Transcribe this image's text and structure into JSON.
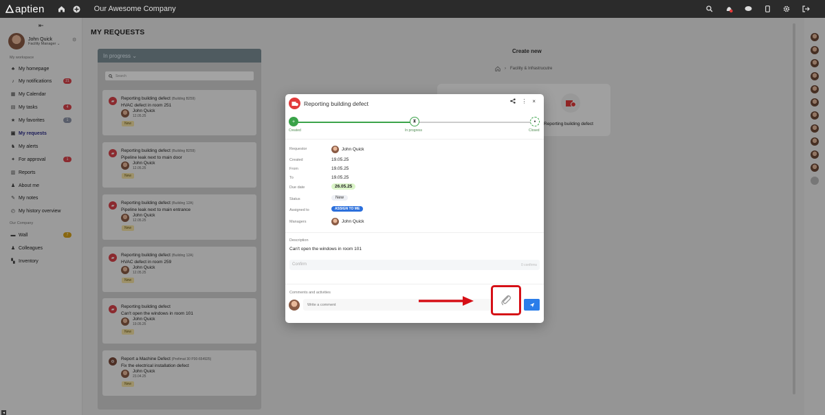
{
  "topbar": {
    "logo": "aptien",
    "company": "Our Awesome Company",
    "icons": [
      "home-icon",
      "add-icon",
      "search-icon",
      "alert-icon",
      "chat-icon",
      "mobile-icon",
      "settings-icon",
      "logout-icon"
    ]
  },
  "sidebar": {
    "user": {
      "name": "John Quick",
      "role": "Facility Manager"
    },
    "section_workspace": "My workspace",
    "section_company": "Our Company",
    "items": [
      {
        "label": "My homepage",
        "icon": "tree-icon"
      },
      {
        "label": "My notifications",
        "icon": "bell-icon",
        "badge": "21",
        "badge_color": "#d9434a"
      },
      {
        "label": "My Calendar",
        "icon": "calendar-icon"
      },
      {
        "label": "My tasks",
        "icon": "tasks-icon",
        "badge": "4",
        "badge_color": "#d9434a"
      },
      {
        "label": "My favorites",
        "icon": "star-icon",
        "badge": "1",
        "badge_color": "#8c94a8"
      },
      {
        "label": "My requests",
        "icon": "requests-icon",
        "active": true
      },
      {
        "label": "My alerts",
        "icon": "dog-icon"
      },
      {
        "label": "For approval",
        "icon": "approval-icon",
        "badge": "1",
        "badge_color": "#d9434a"
      },
      {
        "label": "Reports",
        "icon": "reports-icon"
      },
      {
        "label": "About me",
        "icon": "person-icon"
      },
      {
        "label": "My notes",
        "icon": "notes-icon"
      },
      {
        "label": "My history overview",
        "icon": "history-icon"
      }
    ],
    "company_items": [
      {
        "label": "Wall",
        "icon": "wall-icon",
        "badge": "7",
        "badge_color": "#d6a21a"
      },
      {
        "label": "Colleagues",
        "icon": "colleagues-icon"
      },
      {
        "label": "Inventory",
        "icon": "inventory-icon"
      }
    ]
  },
  "main": {
    "title": "MY REQUESTS",
    "column": {
      "header": "In progress",
      "search_placeholder": "Search",
      "cards": [
        {
          "title": "Reporting building defect",
          "location": "(Building B259)",
          "desc": "HVAC defect in room 251",
          "user": "John Quick",
          "date": "12.05.25",
          "status": "New"
        },
        {
          "title": "Reporting building defect",
          "location": "(Building B259)",
          "desc": "Pipeline leak next to main door",
          "user": "John Quick",
          "date": "12.05.25",
          "status": "New"
        },
        {
          "title": "Reporting building defect",
          "location": "(Building 12A)",
          "desc": "Pipeline leak next to main entrance",
          "user": "John Quick",
          "date": "12.05.25",
          "status": "New"
        },
        {
          "title": "Reporting building defect",
          "location": "(Building 12A)",
          "desc": "HVAC defect in room 259",
          "user": "John Quick",
          "date": "12.05.25",
          "status": "New"
        },
        {
          "title": "Reporting building defect",
          "location": "",
          "desc": "Can't open the windows in room 101",
          "user": "John Quick",
          "date": "19.05.25",
          "status": "New"
        },
        {
          "title": "Report a Machine Defect",
          "location": "(Profimat 30 P30-654925)",
          "desc": "Fix the electrical installation defect",
          "user": "John Quick",
          "date": "23.04.25",
          "status": "New"
        }
      ]
    },
    "create": {
      "title": "Create new",
      "breadcrumb": "Facility & Infrastrucutre",
      "card_label": "Reporting building defect"
    }
  },
  "modal": {
    "title": "Reporting building defect",
    "steps": [
      "Created",
      "In progress",
      "Closed"
    ],
    "fields": {
      "requestor_label": "Requestor",
      "requestor": "John Quick",
      "created_label": "Created",
      "created": "19.05.25",
      "from_label": "From",
      "from": "19.05.25",
      "to_label": "To",
      "to": "19.05.25",
      "due_label": "Due date",
      "due": "26.05.25",
      "status_label": "Status",
      "status": "New",
      "assigned_label": "Assigned to",
      "assign_button": "ASSIGN TO ME",
      "managers_label": "Managers",
      "manager": "John Quick"
    },
    "description_label": "Description",
    "description": "Can't open the windows in room 101",
    "confirm_label": "Confirm",
    "confirm_count": "0 confirms",
    "comments_label": "Comments and activities",
    "comment_placeholder": "Write a comment"
  },
  "colors": {
    "accent": "#2b6fdc",
    "danger": "#d9434a",
    "success": "#3aa349",
    "highlight": "#d50f16"
  }
}
